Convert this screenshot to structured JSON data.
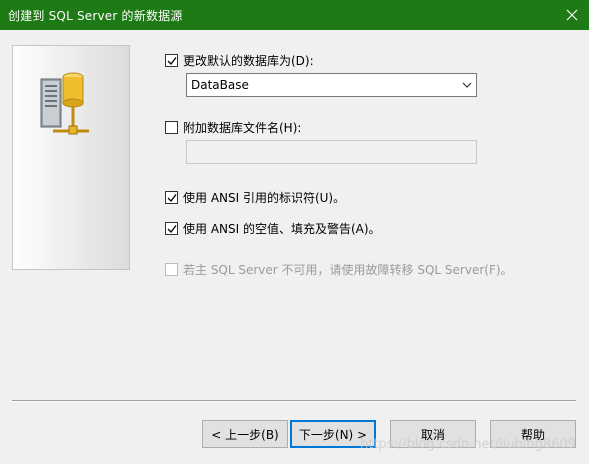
{
  "window": {
    "title": "创建到 SQL Server 的新数据源",
    "close_icon": "close-icon",
    "titlebar_color": "#1e7a14"
  },
  "side_panel": {
    "icon": "database-server-icon"
  },
  "options": {
    "change_default_db": {
      "label": "更改默认的数据库为(D):",
      "checked": true
    },
    "default_db_select": {
      "value": "DataBase"
    },
    "attach_db_file": {
      "label": "附加数据库文件名(H):",
      "checked": false
    },
    "attach_db_input": {
      "value": ""
    },
    "ansi_quoted": {
      "label": "使用 ANSI 引用的标识符(U)。",
      "checked": true
    },
    "ansi_nulls": {
      "label": "使用 ANSI 的空值、填充及警告(A)。",
      "checked": true
    },
    "failover": {
      "label": "若主 SQL Server 不可用，请使用故障转移 SQL Server(F)。",
      "checked": false,
      "enabled": false
    }
  },
  "buttons": {
    "back": "< 上一步(B)",
    "next": "下一步(N) >",
    "cancel": "取消",
    "help": "帮助"
  },
  "watermark": "https://blog.csdn.net/liubing8609"
}
